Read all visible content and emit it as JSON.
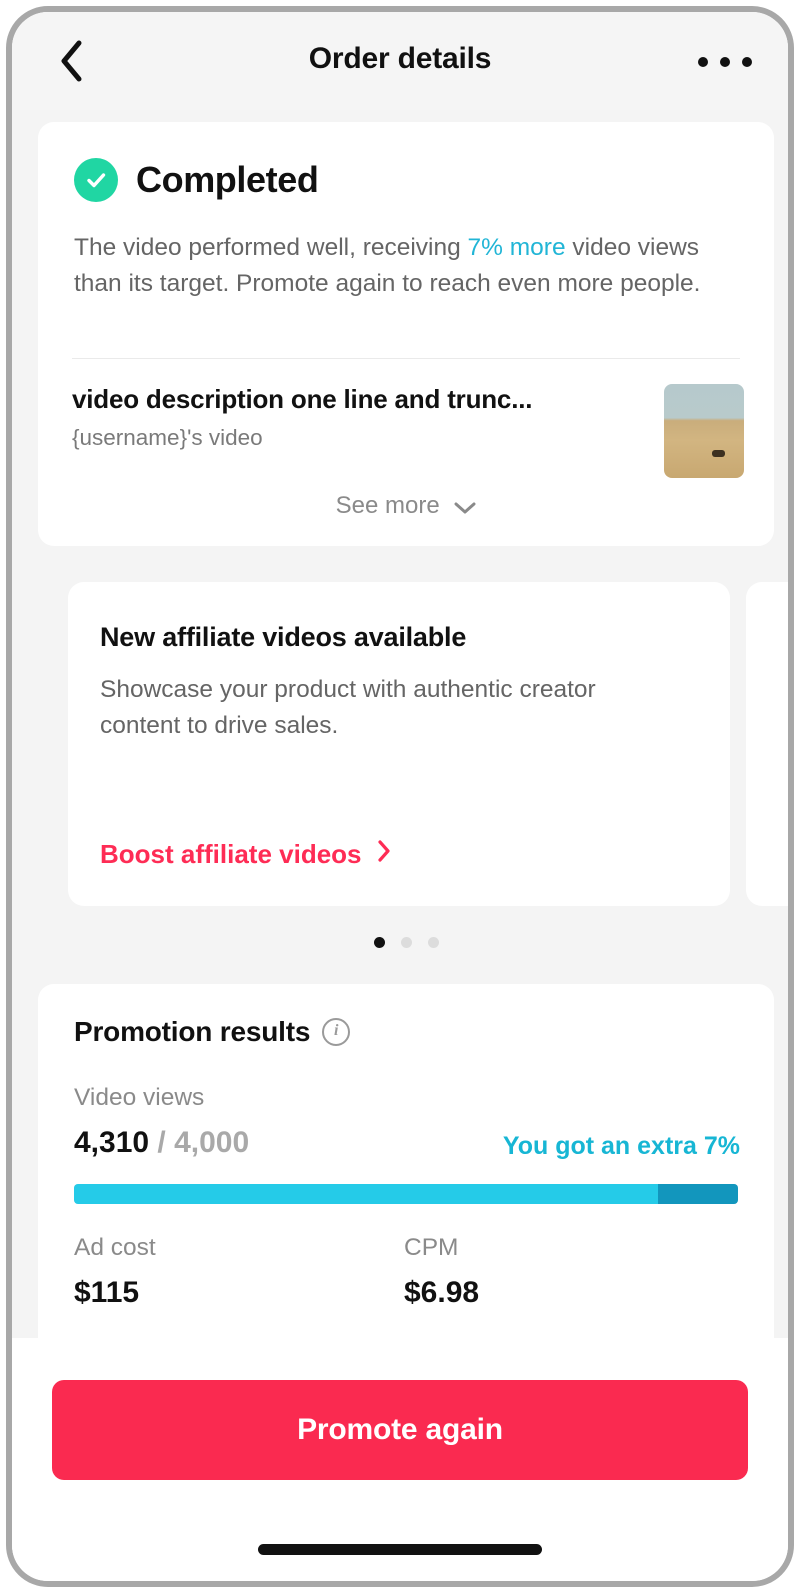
{
  "header": {
    "title": "Order details",
    "back_icon": "chevron-left-icon",
    "more_icon": "more-horizontal-icon"
  },
  "status": {
    "icon": "check-circle-icon",
    "label": "Completed",
    "description_before": "The video performed well, receiving ",
    "description_highlight": "7% more",
    "description_after": " video views than its target. Promote again to reach even more people.",
    "highlight_color": "#21b5d6",
    "icon_color": "#20d6a3"
  },
  "video": {
    "title": "video description one line and trunc...",
    "subtitle": "{username}'s video",
    "thumbnail_alt": "desert-landscape-thumbnail",
    "see_more_label": "See more",
    "see_more_icon": "chevron-down-icon"
  },
  "carousel": {
    "cards": [
      {
        "title": "New affiliate videos available",
        "body": "Showcase your product with authentic creator content to drive sales.",
        "cta": "Boost affiliate videos",
        "cta_icon": "chevron-right-icon",
        "cta_color": "#fe2c55"
      },
      {
        "title": "",
        "body": "",
        "cta": "",
        "cta_icon": "chevron-right-icon",
        "cta_color": "#fe2c55"
      }
    ],
    "active_index": 0,
    "dot_count": 3
  },
  "results": {
    "title": "Promotion results",
    "info_icon": "info-circle-icon",
    "views_label": "Video views",
    "views_actual": "4,310",
    "views_separator": " / ",
    "views_target": "4,000",
    "extra_note": "You got an extra 7%",
    "extra_note_color": "#17b6d4",
    "progress_base_percent": 88,
    "progress_base_color": "#25cbe8",
    "progress_extra_color": "#1296bd",
    "cost_label": "Ad cost",
    "cost_value": "$115",
    "cpm_label": "CPM",
    "cpm_value": "$6.98"
  },
  "footer": {
    "promote_label": "Promote again",
    "promote_color": "#fa2a50"
  }
}
